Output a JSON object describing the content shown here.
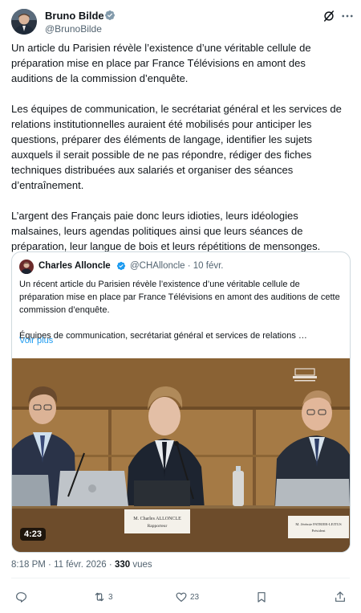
{
  "author": {
    "name": "Bruno Bilde",
    "handle": "@BrunoBilde"
  },
  "icons": {
    "verified": "verified-badge-icon",
    "grok": "grok-icon",
    "more": "more-icon"
  },
  "tweet": {
    "paragraphs": [
      "Un article du Parisien révèle l’existence d’une véritable cellule de préparation mise en place par France Télévisions en amont des auditions de la commission d’enquête.",
      "Les équipes de communication, le secrétariat général et les services de relations institutionnelles auraient été mobilisés pour anticiper les questions, préparer des éléments de langage, identifier les sujets auxquels il serait possible de ne pas répondre, rédiger des fiches techniques distribuées aux salariés et organiser des séances d’entraînement.",
      "L’argent des Français paie donc leurs idioties, leurs idéologies malsaines, leurs agendas politiques ainsi que leurs séances de préparation, leur langue de bois et leurs répétitions de mensonges."
    ],
    "time": "8:18 PM",
    "date": "11 févr. 2026",
    "views_count": "330",
    "views_label": "vues"
  },
  "quote": {
    "name": "Charles Alloncle",
    "handle": "@CHAlloncle · 10 févr.",
    "paragraphs": [
      "Un récent article du Parisien révèle l’existence d’une véritable cellule de préparation mise en place par France Télévisions en amont des auditions de cette commission d’enquête.",
      "Équipes de communication, secrétariat général et services de relations …"
    ],
    "show_more": "Voir plus",
    "video": {
      "duration": "4:23",
      "placard_center_line1": "M. Charles ALLONCLE",
      "placard_center_line2": "Rapporteur",
      "placard_right_line1": "M. Jérémie PATRIER-LEITUS",
      "placard_right_line2": "Président"
    }
  },
  "actions": {
    "reply_count": "",
    "retweet_count": "3",
    "like_count": "23"
  },
  "colors": {
    "accent": "#1d9bf0",
    "text": "#0f1419",
    "muted": "#536471",
    "border": "#cfd9de"
  }
}
